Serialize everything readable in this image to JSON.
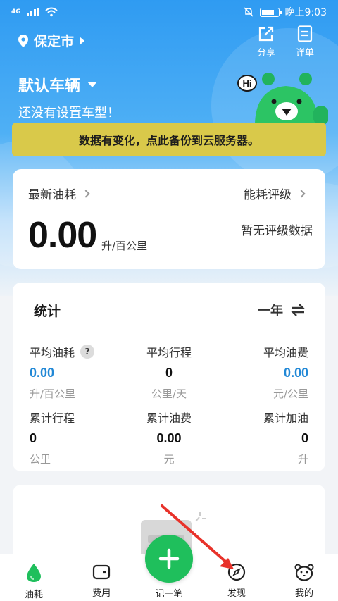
{
  "status_bar": {
    "network": "4G",
    "time": "晚上9:03",
    "battery_level": 0.85
  },
  "header": {
    "city": "保定市",
    "share_label": "分享",
    "detail_label": "详单"
  },
  "vehicle": {
    "name": "默认车辆",
    "subtitle": "还没有设置车型！",
    "mascot_greeting": "Hi"
  },
  "banner": {
    "text": "数据有变化，点此备份到云服务器。"
  },
  "consumption_card": {
    "latest_label": "最新油耗",
    "rating_label": "能耗评级",
    "value": "0.00",
    "unit": "升/百公里",
    "rating_empty": "暂无评级数据"
  },
  "stats": {
    "title": "统计",
    "period": "一年",
    "items": [
      {
        "label": "平均油耗",
        "value": "0.00",
        "unit": "升/百公里",
        "help": "?"
      },
      {
        "label": "平均行程",
        "value": "0",
        "unit": "公里/天"
      },
      {
        "label": "平均油费",
        "value": "0.00",
        "unit": "元/公里"
      },
      {
        "label": "累计行程",
        "value": "0",
        "unit": "公里"
      },
      {
        "label": "累计油费",
        "value": "0.00",
        "unit": "元"
      },
      {
        "label": "累计加油",
        "value": "0",
        "unit": "升"
      }
    ]
  },
  "bottom_nav": {
    "items": [
      {
        "label": "油耗",
        "icon": "drop-icon"
      },
      {
        "label": "费用",
        "icon": "wallet-icon"
      },
      {
        "label": "记一笔",
        "icon": "plus-icon"
      },
      {
        "label": "发现",
        "icon": "compass-icon"
      },
      {
        "label": "我的",
        "icon": "bear-icon"
      }
    ]
  },
  "colors": {
    "primary_blue": "#2f9bf2",
    "banner_yellow": "#d9c94a",
    "accent_green": "#1fbf5c",
    "value_blue": "#2188d6",
    "annotation_red": "#e8322a"
  }
}
